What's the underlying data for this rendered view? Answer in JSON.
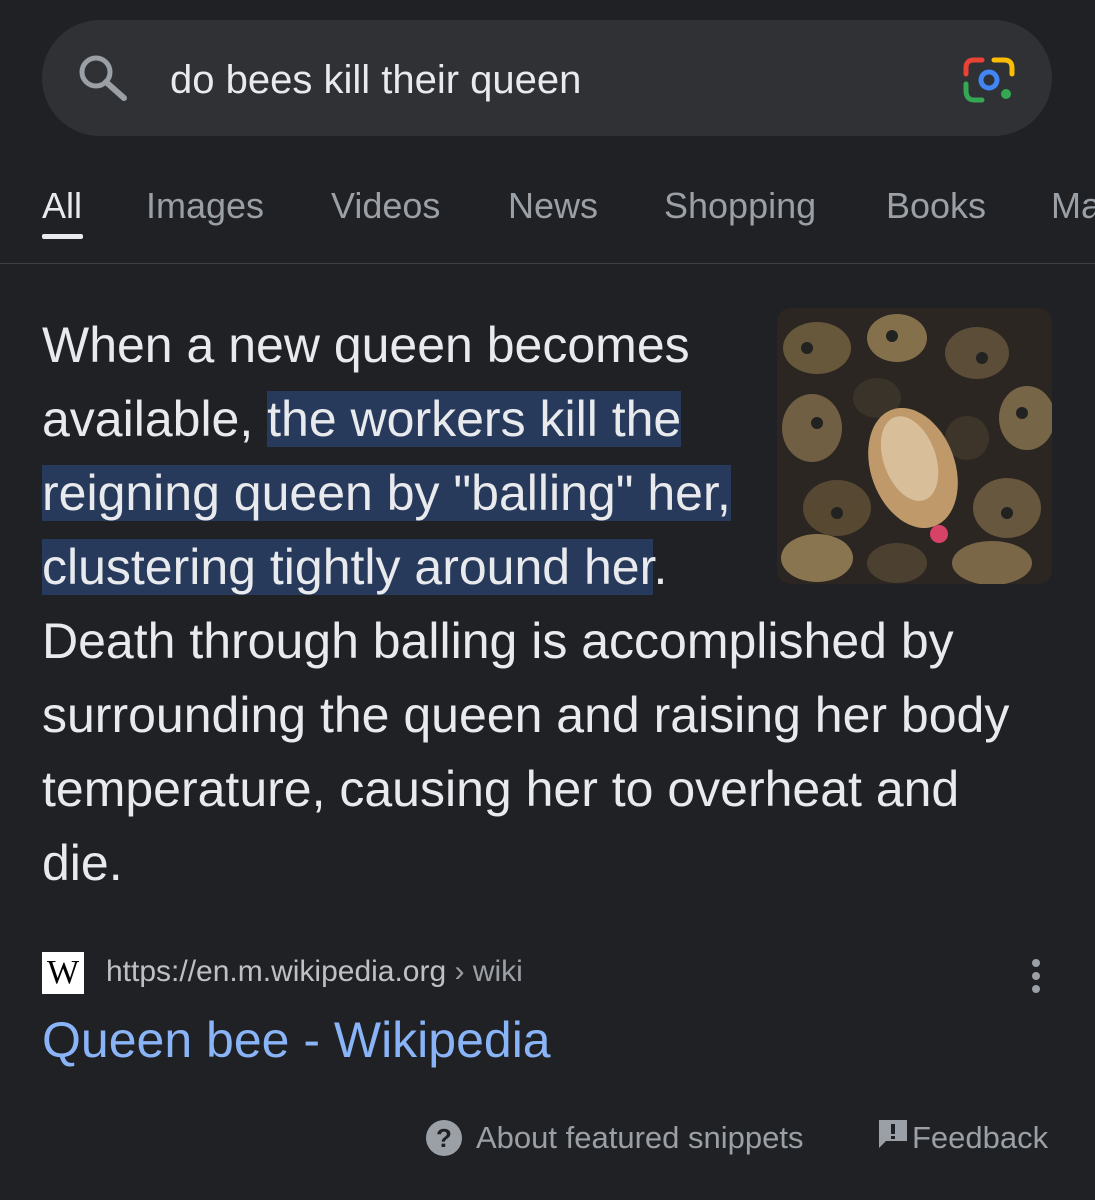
{
  "search": {
    "query": "do bees kill their queen",
    "search_icon": "search-icon",
    "lens_icon": "google-lens-icon"
  },
  "tabs": [
    {
      "label": "All",
      "active": true
    },
    {
      "label": "Images"
    },
    {
      "label": "Videos"
    },
    {
      "label": "News"
    },
    {
      "label": "Shopping"
    },
    {
      "label": "Books"
    },
    {
      "label": "Ma"
    }
  ],
  "snippet": {
    "text_before": "When a new queen becomes available, ",
    "text_highlight": "the workers kill the reigning queen by \"balling\" her, clustering tightly around her",
    "text_after": ". Death through balling is accomplished by surrounding the queen and raising her body temperature, causing her to overheat and die.",
    "highlight_color": "#283a5b"
  },
  "source": {
    "logo_letter": "W",
    "url": "https://en.m.wikipedia.org",
    "crumb": " › wiki",
    "title": "Queen bee - Wikipedia",
    "title_color": "#8ab4f8"
  },
  "footer": {
    "about": "About featured snippets",
    "feedback": "Feedback"
  }
}
